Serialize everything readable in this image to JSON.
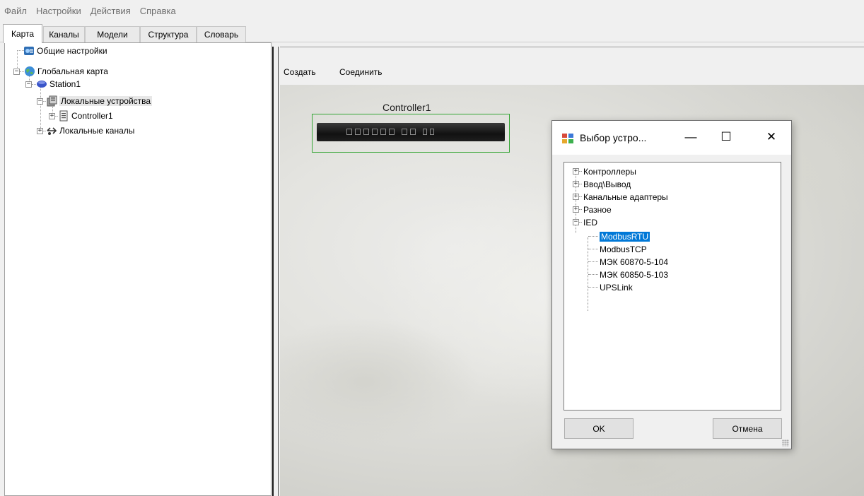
{
  "menu": [
    "Файл",
    "Настройки",
    "Действия",
    "Справка"
  ],
  "tabs": [
    "Карта",
    "Каналы",
    "Модели",
    "Структура",
    "Словарь"
  ],
  "tree": {
    "general_settings": "Общие настройки",
    "global_map": "Глобальная карта",
    "station": "Station1",
    "local_devices": "Локальные устройства",
    "controller": "Controller1",
    "local_channels": "Локальные каналы"
  },
  "toolbar": {
    "create": "Создать",
    "connect": "Соединить"
  },
  "map": {
    "device_label": "Controller1"
  },
  "dialog": {
    "title": "Выбор устро...",
    "minimize": "—",
    "maximize": "☐",
    "close": "✕",
    "categories": [
      "Контроллеры",
      "Ввод\\Вывод",
      "Канальные адаптеры",
      "Разное",
      "IED"
    ],
    "ied_items": [
      "ModbusRTU",
      "ModbusTCP",
      "МЭК 60870-5-104",
      "МЭК 60850-5-103",
      "UPSLink"
    ],
    "selected": "ModbusRTU",
    "ok": "OK",
    "cancel": "Отмена"
  },
  "colors": {
    "selection": "#0078d7",
    "device_frame": "#34a534"
  }
}
